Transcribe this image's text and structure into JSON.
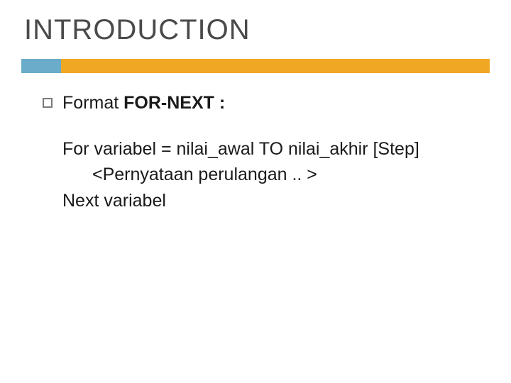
{
  "slide": {
    "title": "INTRODUCTION",
    "bullet": {
      "label_prefix": "Format ",
      "label_bold": "FOR-NEXT :"
    },
    "code": {
      "line1": "For variabel = nilai_awal TO nilai_akhir [Step]",
      "line2": "<Pernyataan perulangan .. >",
      "line3": "Next variabel"
    }
  }
}
